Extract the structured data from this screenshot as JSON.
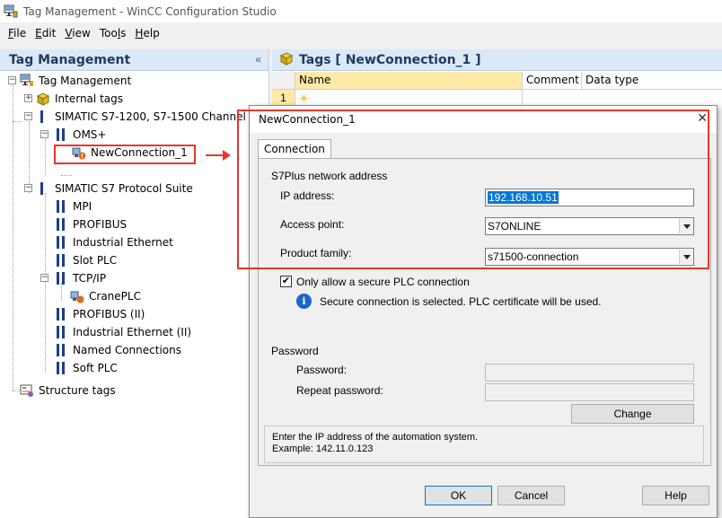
{
  "window": {
    "title": "Tag Management - WinCC Configuration Studio"
  },
  "menu": [
    "File",
    "Edit",
    "View",
    "Tools",
    "Help"
  ],
  "left_panel": {
    "title": "Tag Management",
    "collapse_glyph": "«",
    "tree": {
      "root": "Tag Management",
      "internal_tags": "Internal tags",
      "s7_1200_channel": "SIMATIC S7-1200, S7-1500 Channel",
      "oms": "OMS+",
      "new_connection": "NewConnection_1",
      "s7_protocol_suite": "SIMATIC S7 Protocol Suite",
      "mpi": "MPI",
      "profibus": "PROFIBUS",
      "industrial_ethernet": "Industrial Ethernet",
      "slot_plc": "Slot PLC",
      "tcp_ip": "TCP/IP",
      "crane_plc": "CranePLC",
      "profibus_ii": "PROFIBUS (II)",
      "industrial_ethernet_ii": "Industrial Ethernet (II)",
      "named_connections": "Named Connections",
      "soft_plc": "Soft PLC",
      "structure_tags": "Structure tags"
    }
  },
  "right_panel": {
    "title": "Tags [ NewConnection_1 ]",
    "columns": [
      "Name",
      "Comment",
      "Data type"
    ],
    "rows": [
      {
        "num": "1"
      }
    ]
  },
  "dialog": {
    "title": "NewConnection_1",
    "tab": "Connection",
    "section_address": "S7Plus network address",
    "ip_label": "IP address:",
    "ip_value": "192.168.10.51",
    "access_point_label": "Access point:",
    "access_point_value": "S7ONLINE",
    "product_family_label": "Product family:",
    "product_family_value": "s71500-connection",
    "secure_checkbox_label": "Only allow a secure PLC connection",
    "secure_checked": true,
    "secure_info": "Secure connection is selected. PLC certificate will be used.",
    "section_password": "Password",
    "password_label": "Password:",
    "repeat_password_label": "Repeat password:",
    "change_button": "Change",
    "hint_line1": "Enter the IP address of the automation system.",
    "hint_line2": "Example: 142.11.0.123",
    "ok_button": "OK",
    "cancel_button": "Cancel",
    "help_button": "Help"
  },
  "colors": {
    "highlight_red": "#e8352b",
    "selection_blue": "#0078d7",
    "panel_header": "#dbe8f7"
  }
}
